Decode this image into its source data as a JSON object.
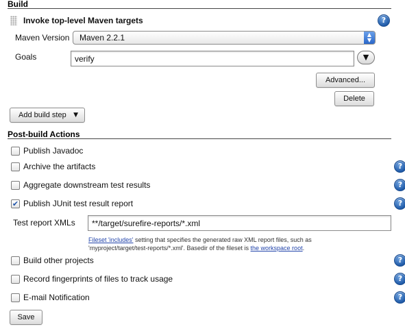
{
  "build": {
    "section_title": "Build",
    "step_title": "Invoke top-level Maven targets",
    "maven_version_label": "Maven Version",
    "maven_version_value": "Maven 2.2.1",
    "goals_label": "Goals",
    "goals_value": "verify",
    "advanced_button": "Advanced...",
    "delete_button": "Delete",
    "add_build_step_button": "Add build step"
  },
  "post_build": {
    "section_title": "Post-build Actions",
    "items": [
      {
        "label": "Publish Javadoc",
        "checked": false
      },
      {
        "label": "Archive the artifacts",
        "checked": false
      },
      {
        "label": "Aggregate downstream test results",
        "checked": false
      },
      {
        "label": "Publish JUnit test result report",
        "checked": true
      },
      {
        "label": "Build other projects",
        "checked": false
      },
      {
        "label": "Record fingerprints of files to track usage",
        "checked": false
      },
      {
        "label": "E-mail Notification",
        "checked": false
      }
    ],
    "test_report_label": "Test report XMLs",
    "test_report_value": "**/target/surefire-reports/*.xml",
    "note": {
      "link1": "Fileset 'includes'",
      "text1": " setting that specifies the generated raw XML report files, such as",
      "text2": "'myproject/target/test-reports/*.xml'. Basedir of the fileset is ",
      "link2": "the workspace root",
      "text3": "."
    }
  },
  "save_button": "Save",
  "icons": {
    "help": "help-icon",
    "checkmark": "checkmark-icon",
    "dropdown": "dropdown-arrow-icon",
    "expand": "expand-arrow-icon",
    "grip": "drag-handle-icon"
  }
}
